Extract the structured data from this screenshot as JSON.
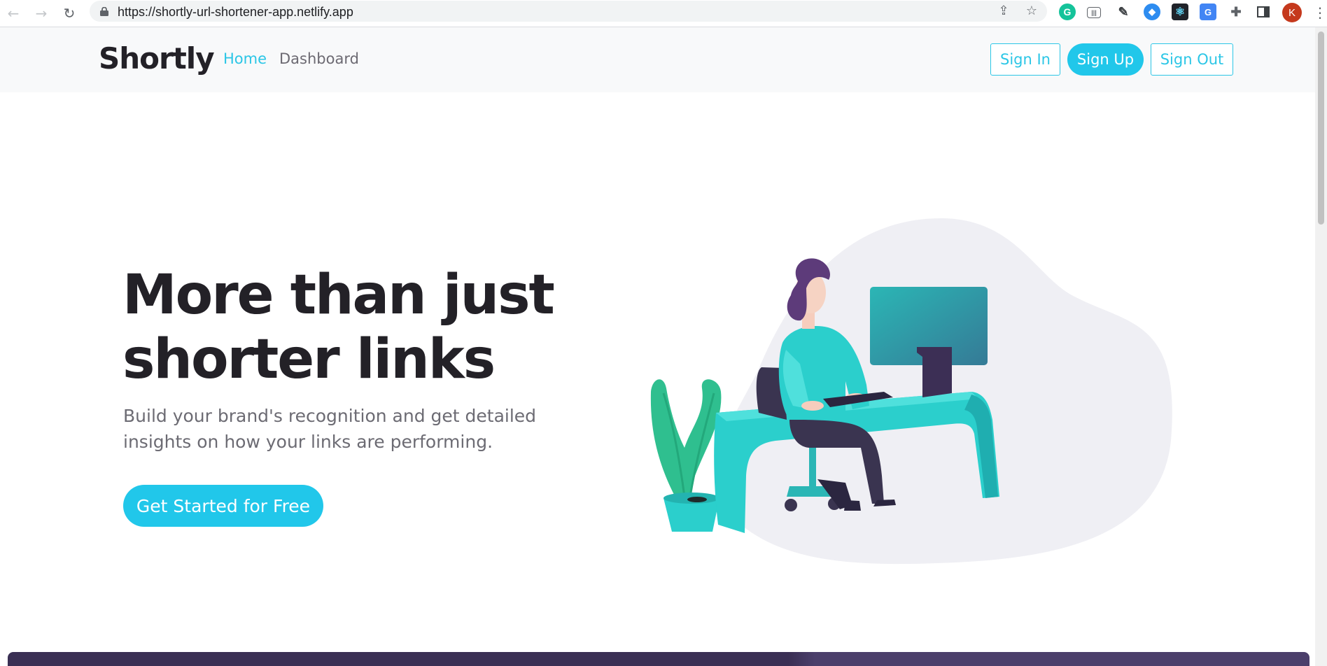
{
  "browser": {
    "url": "https://shortly-url-shortener-app.netlify.app",
    "profile_initial": "K",
    "extensions": [
      "grammarly-icon",
      "barcode-icon",
      "color-picker-icon",
      "metamask-icon",
      "react-devtools-icon",
      "google-translate-icon",
      "puzzle-icon",
      "sidebar-icon"
    ]
  },
  "header": {
    "logo": "Shortly",
    "nav": [
      {
        "label": "Home",
        "active": true
      },
      {
        "label": "Dashboard",
        "active": false
      }
    ],
    "buttons": {
      "sign_in": "Sign In",
      "sign_up": "Sign Up",
      "sign_out": "Sign Out"
    }
  },
  "hero": {
    "title_line1": "More than just",
    "title_line2": "shorter links",
    "subtitle_line1": "Build your brand's recognition and get detailed",
    "subtitle_line2": "insights on how your links are performing.",
    "cta": "Get Started for Free"
  },
  "colors": {
    "accent": "#2bc6e6",
    "dark_text": "#232127",
    "muted_text": "#6c6b73",
    "band": "#3a2f54"
  }
}
